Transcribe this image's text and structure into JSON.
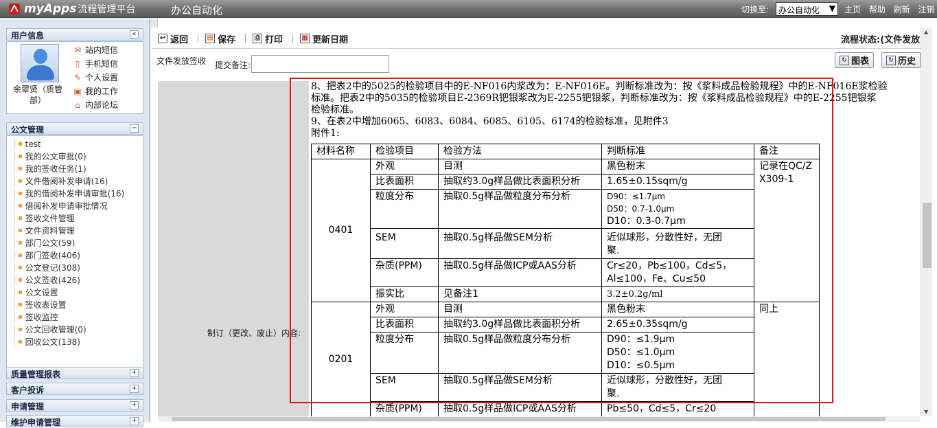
{
  "app": {
    "brand": "myApps",
    "subtitle": "流程管理平台",
    "system_name": "办公自动化"
  },
  "topbar": {
    "switch_label": "切换至:",
    "switch_value": "办公自动化",
    "links": [
      "主页",
      "帮助",
      "刷新",
      "注销"
    ]
  },
  "sidebar": {
    "user_panel_title": "用户信息",
    "user_name": "余翠贤（质管部）",
    "user_menu": [
      {
        "label": "站内短信",
        "icon": "mail-icon"
      },
      {
        "label": "手机短信",
        "icon": "phone-icon"
      },
      {
        "label": "个人设置",
        "icon": "edit-icon"
      },
      {
        "label": "我的工作",
        "icon": "briefcase-icon"
      },
      {
        "label": "内部论坛",
        "icon": "home-icon"
      }
    ],
    "doc_panel_title": "公文管理",
    "doc_items": [
      "test",
      "我的公文审批(0)",
      "我的签收任务(1)",
      "文件借阅补发申请(16)",
      "我的借阅补发申请审批(16)",
      "借阅补发申请审批情况",
      "签收文件管理",
      "文件资料管理",
      "部门公文(59)",
      "部门签收(406)",
      "公文登记(308)",
      "公文签收(426)",
      "公文设置",
      "签收表设置",
      "签收监控",
      "公文回收管理(0)",
      "回收公文(138)"
    ],
    "sections": [
      "质量管理报表",
      "客户投诉",
      "申请管理",
      "维护申请管理"
    ]
  },
  "toolbar": {
    "back": "返回",
    "save": "保存",
    "print": "打印",
    "update_date": "更新日期",
    "flow_status": "流程状态:(文件发放..."
  },
  "form": {
    "step_name": "文件发放签收",
    "remark_label": "提交备注:",
    "remark_value": "",
    "chart_button": "图表",
    "history_button": "历史",
    "revision_label": "制订（更改、废止）内容:"
  },
  "content": {
    "lines": [
      "8、把表2中的5025的检验项目中的E-NF016内浆改为：E-NF016E。判断标准改为：按《浆料成品检验规程》中的E-NF016E浆检验",
      "标准。把表2中的5035的检验项目E-2369R钯银浆改为E-2255钯银浆，判断标准改为：按《浆料成品检验规程》中的E-2255钯银浆",
      "检验标准。",
      "9、在表2中增加6065、6083、6084、6085、6105、6174的检验标准，见附件3",
      "附件1:"
    ],
    "table_headers": [
      "材料名称",
      "检验项目",
      "检验方法",
      "判断标准",
      "备注"
    ],
    "groups": [
      {
        "material": "0401",
        "note": "记录在QC/ZX309-1",
        "rows": [
          {
            "item": "外观",
            "method": "目测",
            "standard": [
              "黑色粉末"
            ]
          },
          {
            "item": "比表面积",
            "method": "抽取约3.0g样品做比表面积分析",
            "standard": [
              "1.65±0.15sqm/g"
            ]
          },
          {
            "item": "粒度分布",
            "method": "抽取0.5g样品做粒度分布分析",
            "standard": [
              "D90：≤1.7μm",
              "D50：0.7-1.0μm",
              "D10：0.3-0.7μm"
            ]
          },
          {
            "item": "SEM",
            "method": "抽取0.5g样品做SEM分析",
            "standard": [
              "近似球形，分散性好，无团",
              "聚."
            ]
          },
          {
            "item": "杂质(PPM)",
            "method": "抽取0.5g样品做ICP或AAS分析",
            "standard": [
              "Cr≤20，Pb≤100，Cd≤5，",
              "Al≤100，Fe、Cu≤50"
            ]
          },
          {
            "item": "振实比",
            "method": "见备注1",
            "standard": [
              " 3.2±0.2g/ml"
            ]
          }
        ]
      },
      {
        "material": "0201",
        "note": "同上",
        "rows": [
          {
            "item": "外观",
            "method": "目测",
            "standard": [
              "黑色粉末"
            ]
          },
          {
            "item": "比表面积",
            "method": "抽取约3.0g样品做比表面积分析",
            "standard": [
              "2.65±0.35sqm/g"
            ]
          },
          {
            "item": "粒度分布",
            "method": "抽取0.5g样品做粒度分布分析",
            "standard": [
              "D90：≤1.9μm",
              "D50：≤1.0μm",
              "D10：≤0.5μm"
            ]
          },
          {
            "item": "SEM",
            "method": "抽取0.5g样品做SEM分析",
            "standard": [
              "近似球形，分散性好，无团",
              "聚."
            ]
          },
          {
            "item": "杂质(PPM)",
            "method": "抽取0.5g样品做ICP或AAS分析",
            "standard": [
              "Pb≤50，Cd≤5，Cr≤20"
            ]
          }
        ]
      }
    ]
  }
}
